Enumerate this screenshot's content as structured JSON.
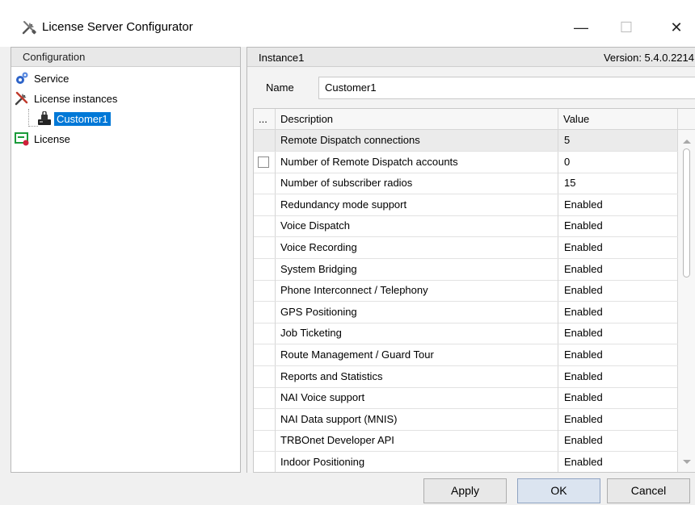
{
  "window": {
    "title": "License Server Configurator",
    "minimize_glyph": "—",
    "maximize_glyph": "☐",
    "close_glyph": "✕",
    "icon": "tools-icon"
  },
  "left_panel": {
    "header": "Configuration",
    "tree": [
      {
        "label": "Service",
        "icon": "gears-icon"
      },
      {
        "label": "License instances",
        "icon": "tools-icon"
      },
      {
        "label": "Customer1",
        "icon": "radio-lock-icon",
        "selected": true
      },
      {
        "label": "License",
        "icon": "license-icon"
      }
    ]
  },
  "right_panel": {
    "instance_title": "Instance1",
    "version": "Version: 5.4.0.2214",
    "name_label": "Name",
    "name_value": "Customer1",
    "grid": {
      "headers": {
        "selector": "...",
        "description": "Description",
        "value": "Value"
      },
      "rows": [
        {
          "description": "Remote Dispatch connections",
          "value": "5"
        },
        {
          "description": "Number of Remote Dispatch accounts",
          "value": "0"
        },
        {
          "description": "Number of subscriber radios",
          "value": "15"
        },
        {
          "description": "Redundancy mode support",
          "value": "Enabled"
        },
        {
          "description": "Voice Dispatch",
          "value": "Enabled"
        },
        {
          "description": "Voice Recording",
          "value": "Enabled"
        },
        {
          "description": "System Bridging",
          "value": "Enabled"
        },
        {
          "description": "Phone Interconnect / Telephony",
          "value": "Enabled"
        },
        {
          "description": "GPS Positioning",
          "value": "Enabled"
        },
        {
          "description": "Job Ticketing",
          "value": "Enabled"
        },
        {
          "description": "Route Management / Guard Tour",
          "value": "Enabled"
        },
        {
          "description": "Reports and Statistics",
          "value": "Enabled"
        },
        {
          "description": "NAI Voice support",
          "value": "Enabled"
        },
        {
          "description": "NAI Data support (MNIS)",
          "value": "Enabled"
        },
        {
          "description": "TRBOnet Developer API",
          "value": "Enabled"
        },
        {
          "description": "Indoor Positioning",
          "value": "Enabled"
        }
      ]
    }
  },
  "buttons": {
    "apply": "Apply",
    "ok": "OK",
    "cancel": "Cancel"
  },
  "colors": {
    "selection": "#0078d7",
    "ok_button": "#dbe4f0"
  }
}
